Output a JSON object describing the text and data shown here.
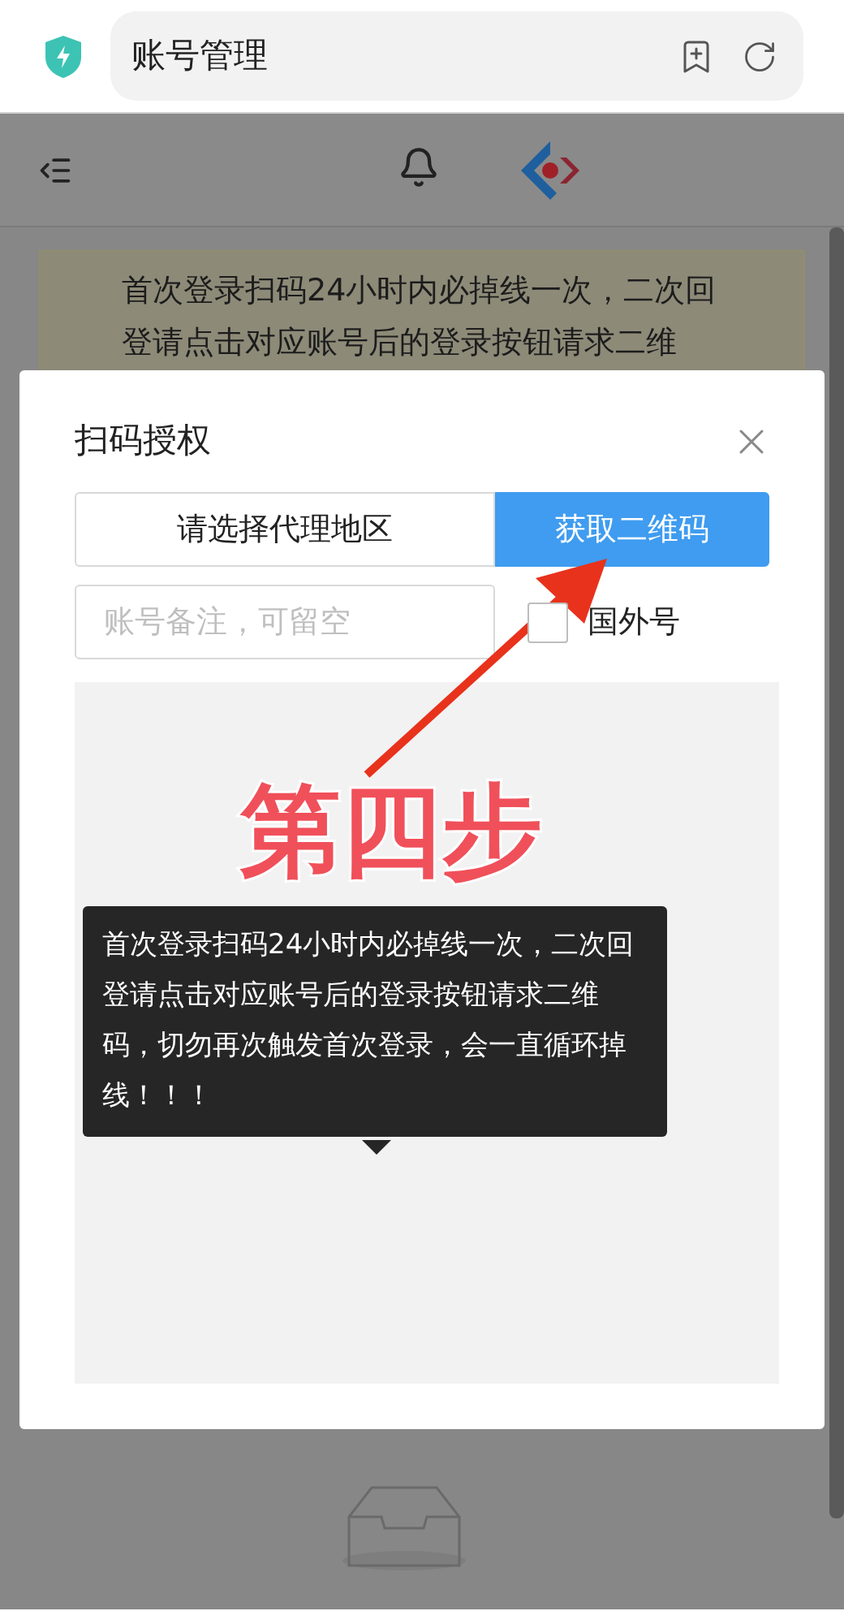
{
  "browser": {
    "title": "账号管理"
  },
  "notice": {
    "lines": [
      "首次登录扫码24小时内必掉线一次，二次回",
      "登请点击对应账号后的登录按钮请求二维"
    ]
  },
  "dialog": {
    "title": "扫码授权",
    "tabs": [
      {
        "label": "请选择代理地区",
        "selected": false
      },
      {
        "label": "获取二维码",
        "selected": true
      }
    ],
    "remark_field": {
      "placeholder": "账号备注，可留空"
    },
    "foreign_checkbox": {
      "label": "国外号",
      "checked": false
    },
    "tooltip": "首次登录扫码24小时内必掉线一次，二次回登请点击对应账号后的登录按钮请求二维码，切勿再次触发首次登录，会一直循环掉线！！！"
  },
  "annotation": {
    "text": "第四步"
  }
}
